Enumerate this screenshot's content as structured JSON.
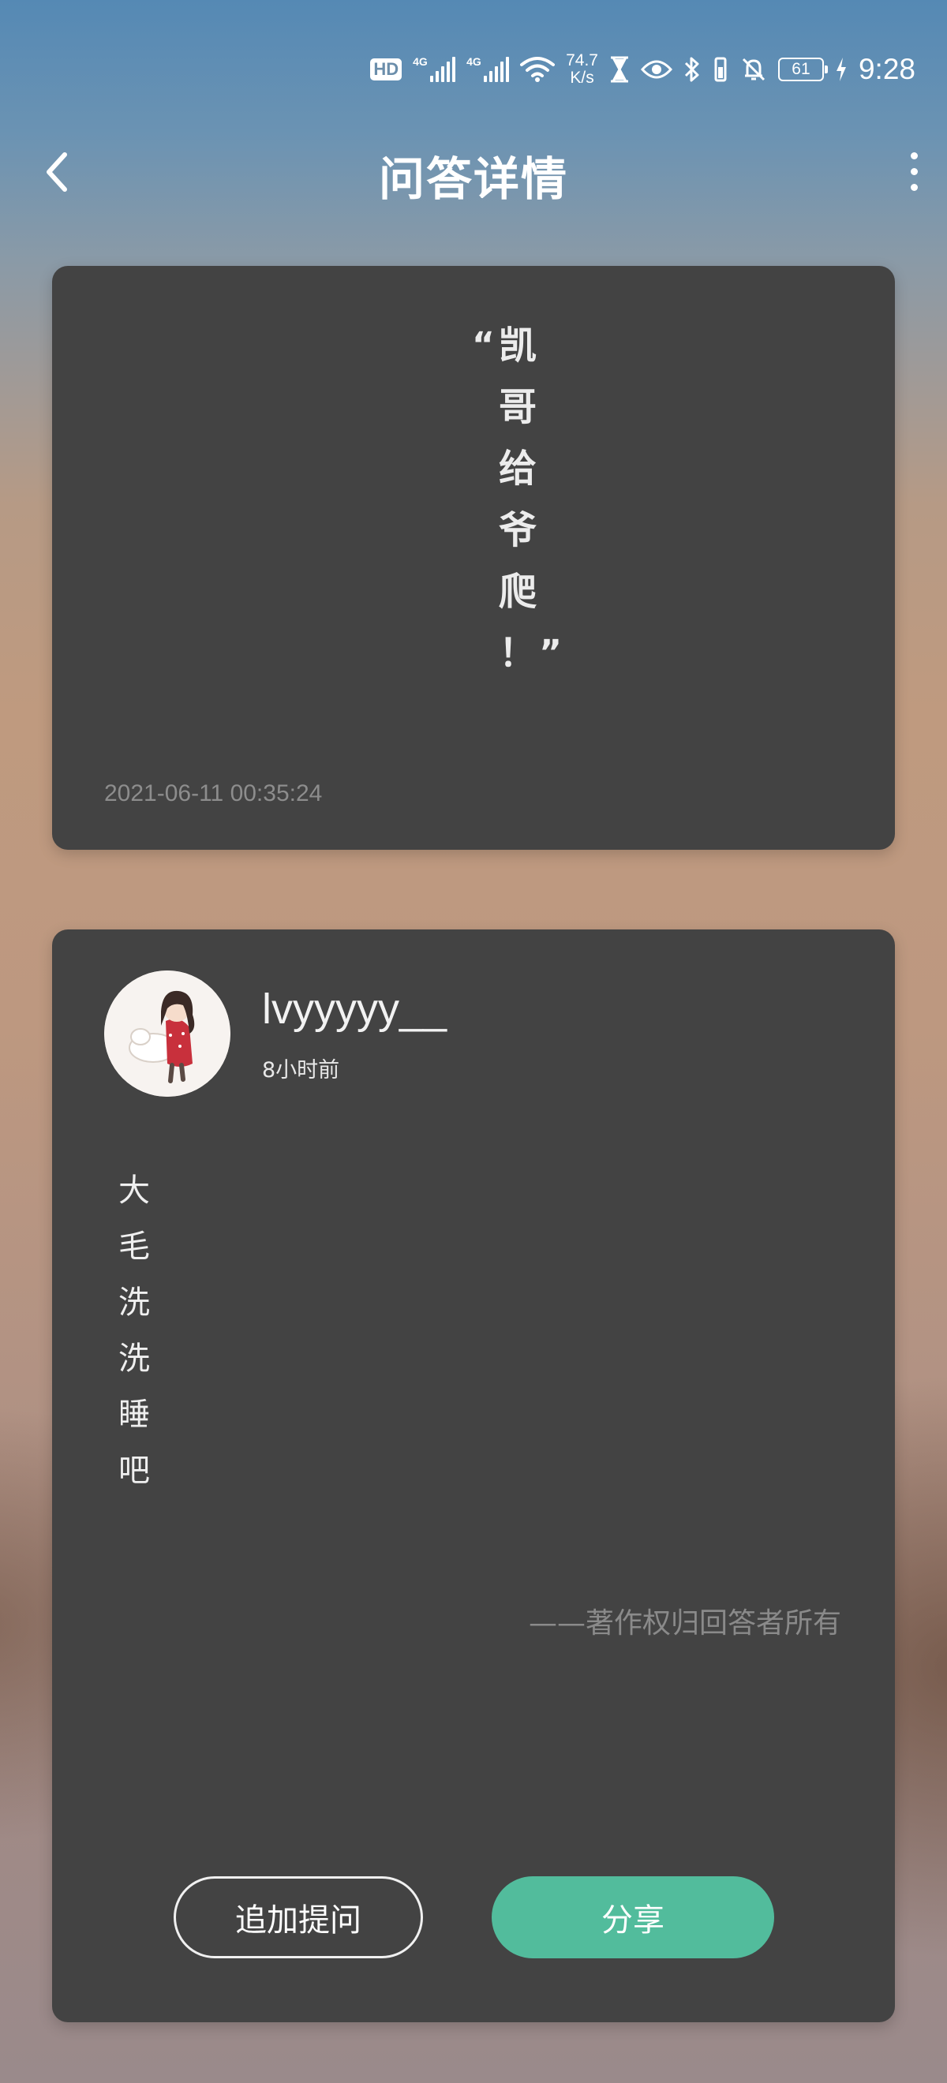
{
  "status_bar": {
    "hd_label": "HD",
    "sim1_tag": "4G",
    "sim2_tag": "4G",
    "net_speed_value": "74.7",
    "net_speed_unit": "K/s",
    "battery_level": "61",
    "time": "9:28",
    "icons": [
      "hd-icon",
      "signal-icon",
      "signal-icon",
      "wifi-icon",
      "hourglass-icon",
      "eye-icon",
      "bluetooth-icon",
      "vibrate-icon",
      "mute-bell-icon",
      "battery-icon",
      "charging-icon"
    ]
  },
  "app_bar": {
    "title": "问答详情",
    "back_icon": "chevron-left-icon",
    "more_icon": "more-vertical-icon"
  },
  "question": {
    "open_quote": "“",
    "chars": [
      "凯",
      "哥",
      "给",
      "爷",
      "爬",
      "！"
    ],
    "close_quote": "”",
    "timestamp": "2021-06-11 00:35:24"
  },
  "answer": {
    "username": "lvyyyyy__",
    "time_ago": "8小时前",
    "chars": [
      "大",
      "毛",
      "洗",
      "洗",
      "睡",
      "吧"
    ],
    "copyright": "——著作权归回答者所有",
    "followup_button": "追加提问",
    "share_button": "分享"
  },
  "colors": {
    "card_bg": "#434343",
    "accent": "#52bc9c"
  }
}
